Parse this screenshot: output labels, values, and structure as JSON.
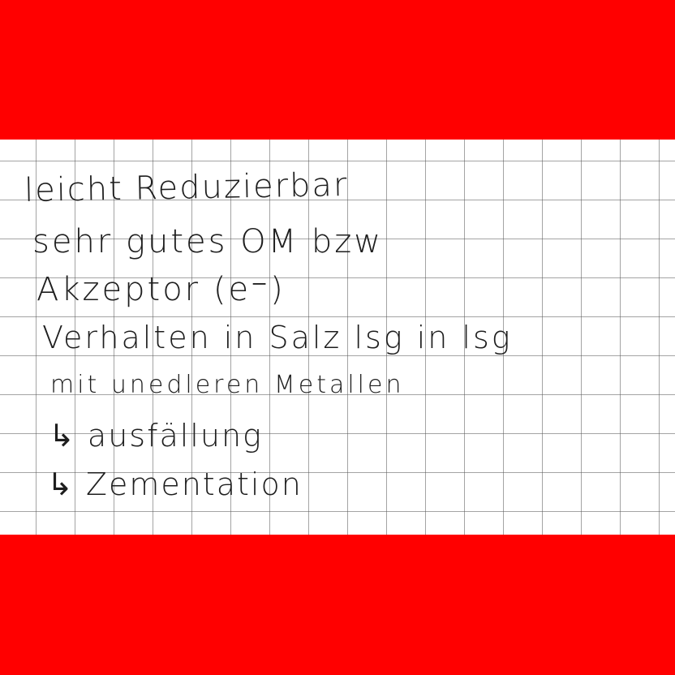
{
  "note": {
    "lines": [
      "leicht Reduzierbar",
      "sehr gutes OM bzw",
      "Akzeptor (e⁻)",
      "Verhalten in Salz lsg in lsg",
      "mit unedleren Metallen",
      "↳ ausfällung",
      "↳ Zementation"
    ]
  },
  "colors": {
    "frame": "#ff0000",
    "paper": "#ffffff",
    "grid": "#5a5a5a",
    "ink": "#1e1e1e"
  }
}
